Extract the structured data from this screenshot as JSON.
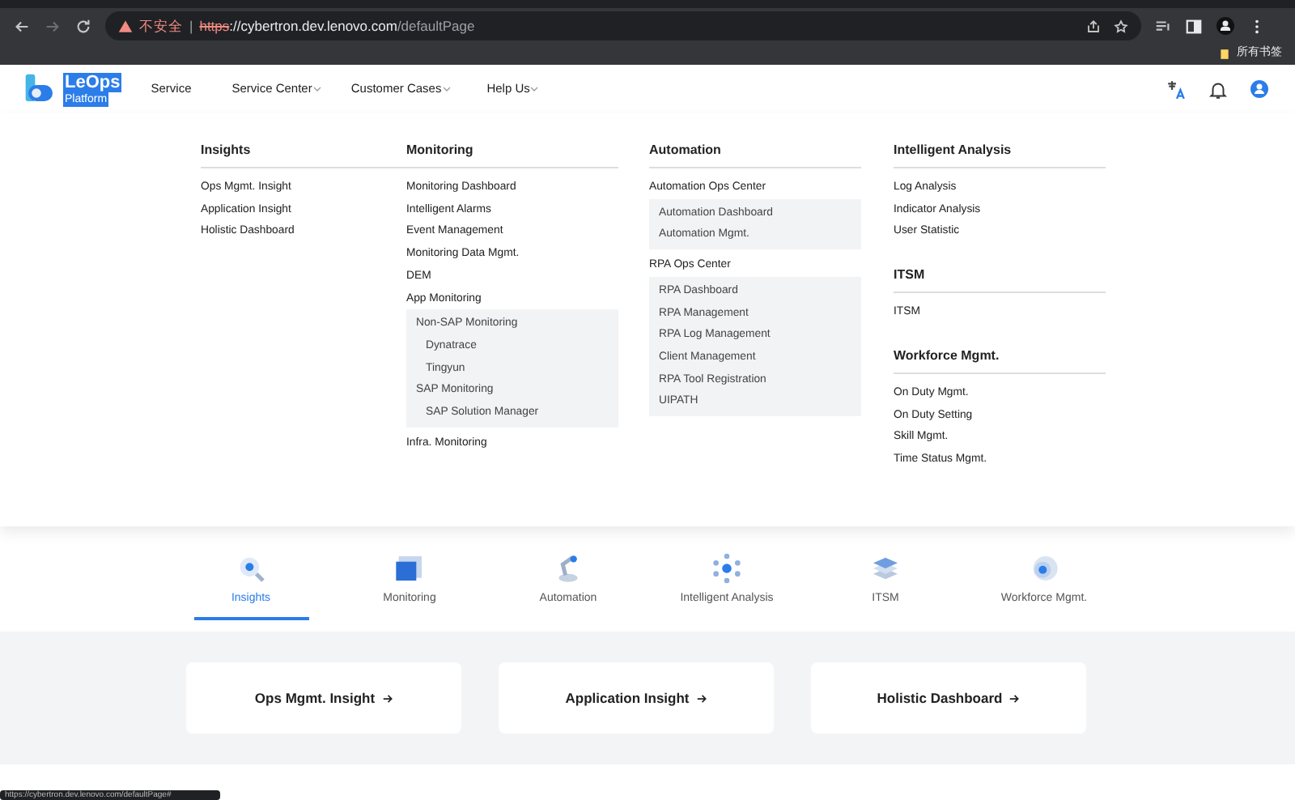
{
  "browser": {
    "warning": "不安全",
    "separator": "|",
    "url_scheme": "https",
    "url_host": "://cybertron.dev.lenovo.com",
    "url_path": "/defaultPage",
    "bookmark": "所有书签",
    "status_link": "https://cybertron.dev.lenovo.com/defaultPage#"
  },
  "header": {
    "logo_title": "LeOps",
    "logo_subtitle": "Platform",
    "logo_highlighted": true,
    "nav": [
      {
        "label": "Service",
        "dropdown": false
      },
      {
        "label": "Service Center",
        "dropdown": true
      },
      {
        "label": "Customer Cases",
        "dropdown": true
      },
      {
        "label": "Help Us",
        "dropdown": true
      }
    ]
  },
  "menu": [
    {
      "sections": [
        {
          "heading": "Insights",
          "items": [
            {
              "label": "Ops Mgmt. Insight"
            },
            {
              "label": "Application Insight"
            },
            {
              "label": "Holistic Dashboard"
            }
          ]
        }
      ]
    },
    {
      "sections": [
        {
          "heading": "Monitoring",
          "items": [
            {
              "label": "Monitoring Dashboard"
            },
            {
              "label": "Intelligent Alarms"
            },
            {
              "label": "Event Management"
            },
            {
              "label": "Monitoring Data Mgmt."
            },
            {
              "label": "DEM"
            },
            {
              "label": "App Monitoring"
            },
            {
              "kind": "panel",
              "children": [
                {
                  "label": "Non-SAP Monitoring",
                  "children": [
                    {
                      "label": "Dynatrace"
                    },
                    {
                      "label": "Tingyun"
                    }
                  ]
                },
                {
                  "label": "SAP Monitoring",
                  "children": [
                    {
                      "label": "SAP Solution Manager"
                    }
                  ]
                }
              ]
            },
            {
              "label": "Infra. Monitoring"
            }
          ]
        }
      ]
    },
    {
      "sections": [
        {
          "heading": "Automation",
          "items": [
            {
              "label": "Automation Ops Center"
            },
            {
              "kind": "panel",
              "children": [
                {
                  "label": "Automation Dashboard"
                },
                {
                  "label": "Automation Mgmt."
                }
              ]
            },
            {
              "label": "RPA Ops Center"
            },
            {
              "kind": "panel",
              "children": [
                {
                  "label": "RPA Dashboard"
                },
                {
                  "label": "RPA Management"
                },
                {
                  "label": "RPA Log Management"
                },
                {
                  "label": "Client Management"
                },
                {
                  "label": "RPA Tool Registration"
                },
                {
                  "label": "UIPATH"
                }
              ]
            }
          ]
        }
      ]
    },
    {
      "sections": [
        {
          "heading": "Intelligent Analysis",
          "items": [
            {
              "label": "Log Analysis"
            },
            {
              "label": "Indicator Analysis"
            },
            {
              "label": "User Statistic"
            }
          ]
        },
        {
          "heading": "ITSM",
          "items": [
            {
              "label": "ITSM"
            }
          ]
        },
        {
          "heading": "Workforce Mgmt.",
          "items": [
            {
              "label": "On Duty Mgmt."
            },
            {
              "label": "On Duty Setting"
            },
            {
              "label": "Skill Mgmt."
            },
            {
              "label": "Time Status Mgmt."
            }
          ]
        }
      ]
    }
  ],
  "tabs": [
    {
      "label": "Insights",
      "selected": true
    },
    {
      "label": "Monitoring",
      "selected": false
    },
    {
      "label": "Automation",
      "selected": false
    },
    {
      "label": "Intelligent Analysis",
      "selected": false
    },
    {
      "label": "ITSM",
      "selected": false
    },
    {
      "label": "Workforce Mgmt.",
      "selected": false
    }
  ],
  "cards": [
    {
      "label": "Ops Mgmt. Insight"
    },
    {
      "label": "Application Insight"
    },
    {
      "label": "Holistic Dashboard"
    }
  ]
}
